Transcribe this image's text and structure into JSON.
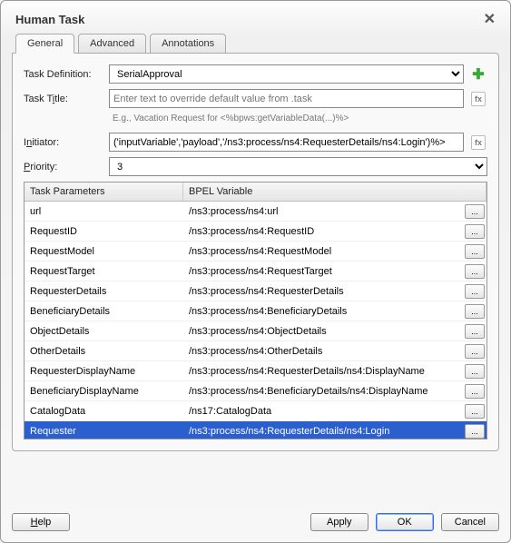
{
  "dialog": {
    "title": "Human Task"
  },
  "tabs": [
    {
      "label": "General",
      "active": true
    },
    {
      "label": "Advanced",
      "active": false
    },
    {
      "label": "Annotations",
      "active": false
    }
  ],
  "form": {
    "task_def_label": "Task Definition:",
    "task_def_value": "SerialApproval",
    "task_title_label": "Task Title:",
    "task_title_placeholder": "Enter text to override default value from .task",
    "task_title_hint": "E.g., Vacation Request for <%bpws:getVariableData(...)%>",
    "initiator_label": "Initiator:",
    "initiator_value": "('inputVariable','payload','/ns3:process/ns4:RequesterDetails/ns4:Login')%>",
    "priority_label": "Priority:",
    "priority_value": "3"
  },
  "table": {
    "header_param": "Task Parameters",
    "header_var": "BPEL Variable",
    "row_button_label": "...",
    "rows": [
      {
        "param": "url",
        "variable": "/ns3:process/ns4:url",
        "selected": false
      },
      {
        "param": "RequestID",
        "variable": "/ns3:process/ns4:RequestID",
        "selected": false
      },
      {
        "param": "RequestModel",
        "variable": "/ns3:process/ns4:RequestModel",
        "selected": false
      },
      {
        "param": "RequestTarget",
        "variable": "/ns3:process/ns4:RequestTarget",
        "selected": false
      },
      {
        "param": "RequesterDetails",
        "variable": "/ns3:process/ns4:RequesterDetails",
        "selected": false
      },
      {
        "param": "BeneficiaryDetails",
        "variable": "/ns3:process/ns4:BeneficiaryDetails",
        "selected": false
      },
      {
        "param": "ObjectDetails",
        "variable": "/ns3:process/ns4:ObjectDetails",
        "selected": false
      },
      {
        "param": "OtherDetails",
        "variable": "/ns3:process/ns4:OtherDetails",
        "selected": false
      },
      {
        "param": "RequesterDisplayName",
        "variable": "/ns3:process/ns4:RequesterDetails/ns4:DisplayName",
        "selected": false
      },
      {
        "param": "BeneficiaryDisplayName",
        "variable": "/ns3:process/ns4:BeneficiaryDetails/ns4:DisplayName",
        "selected": false
      },
      {
        "param": "CatalogData",
        "variable": "/ns17:CatalogData",
        "selected": false
      },
      {
        "param": "Requester",
        "variable": "/ns3:process/ns4:RequesterDetails/ns4:Login",
        "selected": true
      }
    ]
  },
  "buttons": {
    "help": "Help",
    "apply": "Apply",
    "ok": "OK",
    "cancel": "Cancel"
  }
}
